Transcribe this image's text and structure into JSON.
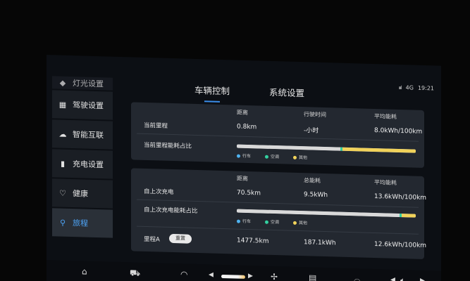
{
  "status": {
    "signal": "ıııl",
    "network": "4G",
    "time": "19:21"
  },
  "tabs": [
    {
      "label": "车辆控制",
      "active": true
    },
    {
      "label": "系统设置",
      "active": false
    }
  ],
  "sidebar": {
    "items": [
      {
        "label": "灯光设置",
        "icon": "light-icon"
      },
      {
        "label": "驾驶设置",
        "icon": "drive-icon"
      },
      {
        "label": "智能互联",
        "icon": "cloud-icon"
      },
      {
        "label": "充电设置",
        "icon": "charge-icon"
      },
      {
        "label": "健康",
        "icon": "health-icon"
      },
      {
        "label": "旅程",
        "icon": "trip-icon",
        "active": true
      }
    ]
  },
  "current_trip": {
    "headers": [
      "距离",
      "行驶时间",
      "平均能耗"
    ],
    "row_label": "当前里程",
    "values": [
      "0.8km",
      "-小时",
      "8.0kWh/100km"
    ],
    "share_label": "当前里程能耗占比",
    "share": {
      "drive": 0.58,
      "ac": 0.01,
      "other": 0.41
    }
  },
  "since_charge": {
    "headers": [
      "距离",
      "总能耗",
      "平均能耗"
    ],
    "row_label": "自上次充电",
    "values": [
      "70.5km",
      "9.5kWh",
      "13.6kWh/100km"
    ],
    "share_label": "自上次充电能耗占比",
    "share": {
      "drive": 0.91,
      "ac": 0.01,
      "other": 0.08
    },
    "trip_a_label": "里程A",
    "reset_label": "重置",
    "trip_a_values": [
      "1477.5km",
      "187.1kWh",
      "12.6kWh/100km"
    ]
  },
  "legend": [
    {
      "label": "行车",
      "color": "#4fb3f0"
    },
    {
      "label": "空调",
      "color": "#33d0a0"
    },
    {
      "label": "其他",
      "color": "#f1d25a"
    }
  ],
  "colors": {
    "accent": "#3b8eea",
    "bar_track": "#d9d9d9",
    "panel": "#232830"
  },
  "dock": {
    "items": [
      "home-icon",
      "car-icon",
      "defrost-front-icon",
      "temp-left-icon",
      "temp-slider",
      "temp-right-icon",
      "fan-icon",
      "defrost-rear-icon",
      "vehicle-icon",
      "volume-down-icon",
      "volume-icon",
      "volume-up-icon"
    ]
  }
}
